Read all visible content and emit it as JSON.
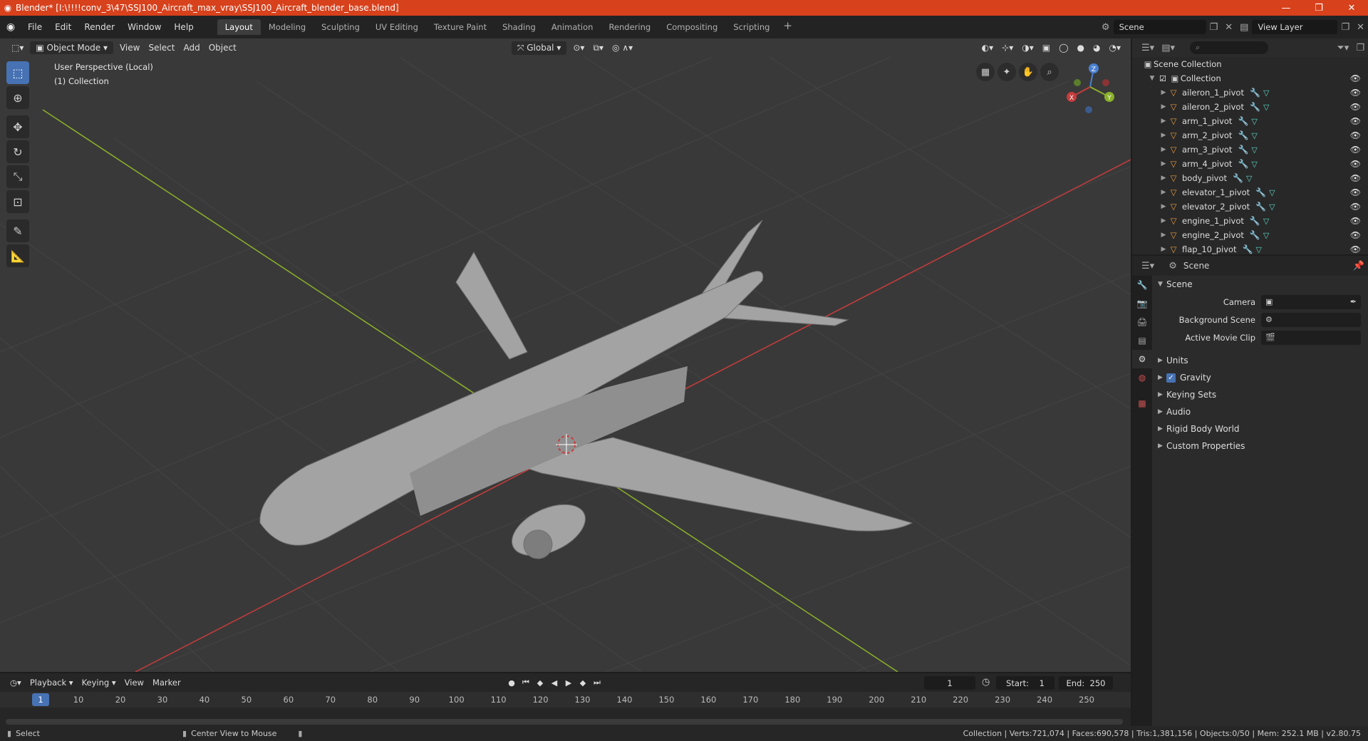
{
  "window": {
    "title": "Blender* [I:\\!!!!conv_3\\47\\SSJ100_Aircraft_max_vray\\SSJ100_Aircraft_blender_base.blend]",
    "minimize": "—",
    "maximize": "❐",
    "close": "✕"
  },
  "menu": [
    "File",
    "Edit",
    "Render",
    "Window",
    "Help"
  ],
  "workspaces": [
    "Layout",
    "Modeling",
    "Sculpting",
    "UV Editing",
    "Texture Paint",
    "Shading",
    "Animation",
    "Rendering",
    "Compositing",
    "Scripting"
  ],
  "active_workspace": "Layout",
  "scene_field": "Scene",
  "view_layer_field": "View Layer",
  "viewport": {
    "mode": "Object Mode",
    "menus": [
      "View",
      "Select",
      "Add",
      "Object"
    ],
    "orientation": "Global",
    "info_line1": "User Perspective (Local)",
    "info_line2": "(1) Collection",
    "gizmo": {
      "z": "Z",
      "y": "Y",
      "x": "X"
    }
  },
  "outliner": {
    "root": "Scene Collection",
    "collection": "Collection",
    "items": [
      "aileron_1_pivot",
      "aileron_2_pivot",
      "arm_1_pivot",
      "arm_2_pivot",
      "arm_3_pivot",
      "arm_4_pivot",
      "body_pivot",
      "elevator_1_pivot",
      "elevator_2_pivot",
      "engine_1_pivot",
      "engine_2_pivot",
      "flap_10_pivot"
    ]
  },
  "properties": {
    "context": "Scene",
    "panel": "Scene",
    "fields": [
      {
        "label": "Camera"
      },
      {
        "label": "Background Scene"
      },
      {
        "label": "Active Movie Clip"
      }
    ],
    "sections": [
      "Units",
      "Gravity",
      "Keying Sets",
      "Audio",
      "Rigid Body World",
      "Custom Properties"
    ]
  },
  "timeline": {
    "menus": [
      "Playback",
      "Keying",
      "View",
      "Marker"
    ],
    "current_frame": "1",
    "start_label": "Start:",
    "start": "1",
    "end_label": "End:",
    "end": "250",
    "ruler": [
      1,
      10,
      20,
      30,
      40,
      50,
      60,
      70,
      80,
      90,
      100,
      110,
      120,
      130,
      140,
      150,
      160,
      170,
      180,
      190,
      200,
      210,
      220,
      230,
      240,
      250
    ]
  },
  "status": {
    "left1": "Select",
    "left2": "Center View to Mouse",
    "right": "Collection | Verts:721,074 | Faces:690,578 | Tris:1,381,156 | Objects:0/50 | Mem: 252.1 MB | v2.80.75"
  },
  "colors": {
    "title_bar": "#d7411c",
    "accent": "#4772b3",
    "x_axis": "#c83c3c",
    "y_axis": "#8bb12a"
  }
}
